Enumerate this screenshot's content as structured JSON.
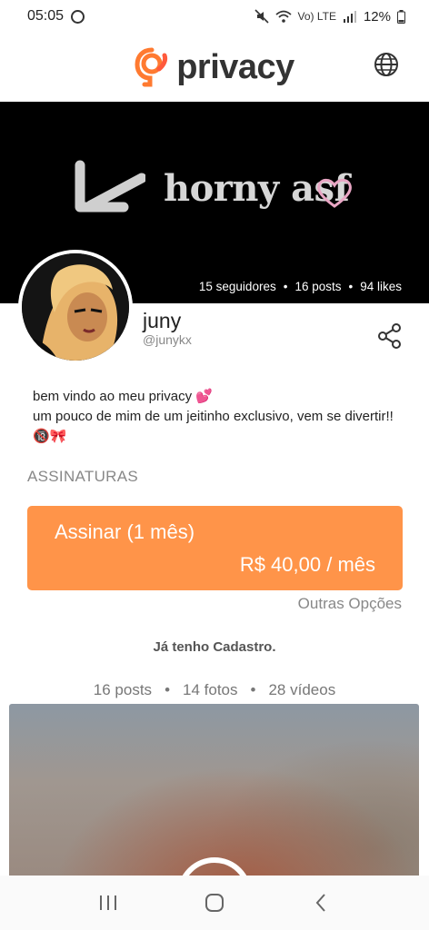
{
  "status_bar": {
    "time": "05:05",
    "battery": "12%",
    "network": "Vo) LTE"
  },
  "header": {
    "logo_text": "privacy",
    "brand_color": "#ff7a30"
  },
  "banner": {
    "text": "horny asf",
    "stats": {
      "followers": "15 seguidores",
      "posts": "16 posts",
      "likes": "94 likes",
      "separator": "•"
    }
  },
  "profile": {
    "name": "juny",
    "handle": "@junykx"
  },
  "bio": {
    "line1": "bem vindo ao meu privacy 💕",
    "line2": "um pouco de mim de um jeitinho exclusivo, vem se divertir!! 🔞🎀"
  },
  "subscriptions": {
    "title": "ASSINATURAS",
    "plan_label": "Assinar (1 mês)",
    "plan_price": "R$ 40,00 / mês",
    "accent_color": "#ff9449",
    "other_options": "Outras Opções"
  },
  "login": {
    "label": "Já tenho Cadastro."
  },
  "content_counts": {
    "posts": "16 posts",
    "photos": "14 fotos",
    "videos": "28 vídeos",
    "separator": "•"
  },
  "icons": {
    "globe": "globe-icon",
    "share": "share-icon",
    "nav_recent": "recent-apps-icon",
    "nav_home": "home-icon",
    "nav_back": "back-icon"
  }
}
